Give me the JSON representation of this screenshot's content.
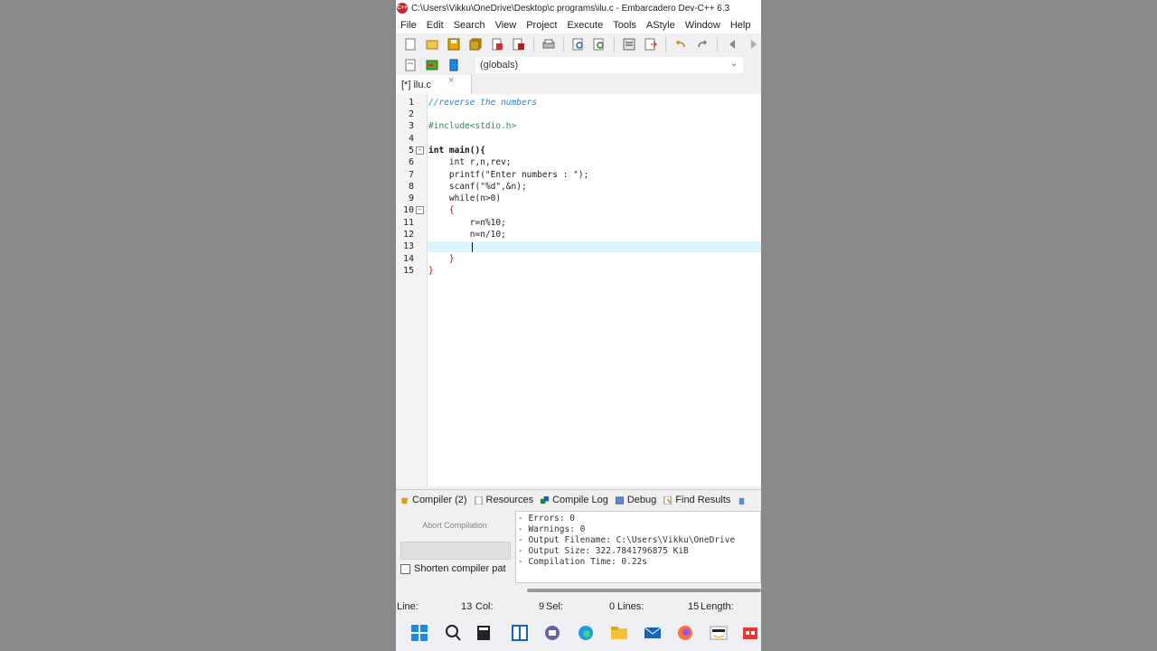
{
  "window": {
    "title": "C:\\Users\\Vikku\\OneDrive\\Desktop\\c programs\\ilu.c - Embarcadero Dev-C++ 6.3",
    "logo_text": "C++"
  },
  "menu": [
    "File",
    "Edit",
    "Search",
    "View",
    "Project",
    "Execute",
    "Tools",
    "AStyle",
    "Window",
    "Help"
  ],
  "scope_dropdown": {
    "value": "(globals)"
  },
  "file_tab": {
    "label": "[*] ilu.c",
    "close": "×"
  },
  "editor": {
    "line_numbers": [
      "1",
      "2",
      "3",
      "4",
      "5",
      "6",
      "7",
      "8",
      "9",
      "10",
      "11",
      "12",
      "13",
      "14",
      "15"
    ],
    "current_line": 13,
    "lines": [
      "//reverse the numbers",
      "",
      "#include<stdio.h>",
      "",
      "int main(){",
      "    int r,n,rev;",
      "    printf(\"Enter numbers : \");",
      "    scanf(\"%d\",&n);",
      "    while(n>0)",
      "    {",
      "        r=n%10;",
      "        n=n/10;",
      "",
      "    }",
      "}"
    ]
  },
  "bottom_panel": {
    "tabs": [
      {
        "label": "Compiler (2)",
        "icon": "compiler-icon"
      },
      {
        "label": "Resources",
        "icon": "resources-icon"
      },
      {
        "label": "Compile Log",
        "icon": "compile-log-icon"
      },
      {
        "label": "Debug",
        "icon": "debug-icon"
      },
      {
        "label": "Find Results",
        "icon": "find-results-icon"
      }
    ],
    "abort_label": "Abort Compilation",
    "shorten_label": "Shorten compiler pat",
    "log_lines": [
      "- Errors: 0",
      "- Warnings: 0",
      "- Output Filename: C:\\Users\\Vikku\\OneDrive",
      "- Output Size: 322.7841796875 KiB",
      "- Compilation Time: 0.22s"
    ]
  },
  "status": {
    "line_label": "Line:",
    "line_value": "13",
    "col_label": "Col:",
    "col_value": "9",
    "sel_label": "Sel:",
    "sel_value": "0",
    "lines_label": "Lines:",
    "lines_value": "15",
    "length_label": "Length:"
  },
  "taskbar_icons": [
    "windows-start-icon",
    "search-icon",
    "file-explorer-dark-icon",
    "snap-layout-icon",
    "teams-chat-icon",
    "edge-browser-icon",
    "folder-icon",
    "mail-icon",
    "firefox-icon",
    "amazon-icon",
    "store-icon"
  ],
  "colors": {
    "current_line_highlight": "#d8f6fb",
    "comment": "#2a7fcf",
    "preprocessor": "#2e8b57",
    "string": "#0033aa"
  }
}
